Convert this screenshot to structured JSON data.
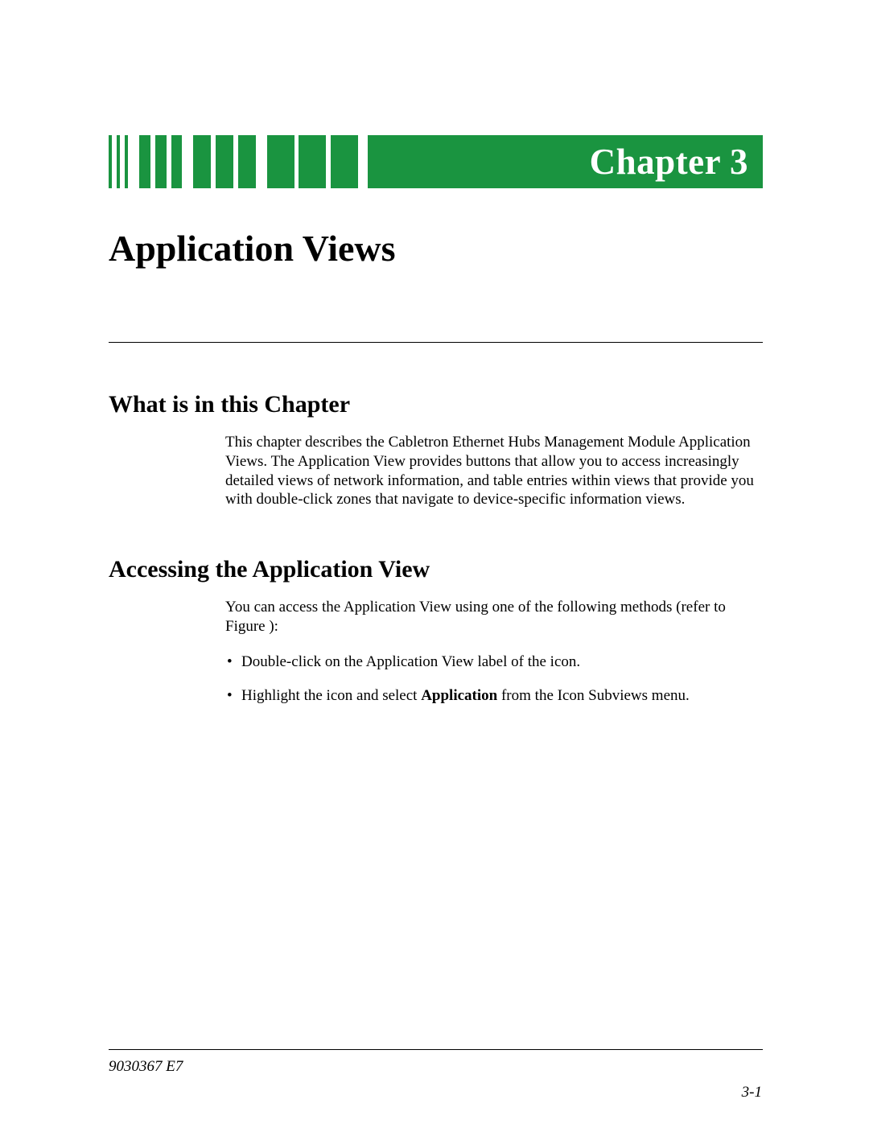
{
  "banner": {
    "label": "Chapter 3"
  },
  "chapter_title": "Application Views",
  "sections": {
    "s1": {
      "heading": "What is in this Chapter",
      "body": "This chapter describes the Cabletron Ethernet Hubs Management Module Application Views. The Application View provides buttons that allow you to access increasingly detailed views of network information, and table entries within views that provide you with double-click zones that navigate to device-specific information views."
    },
    "s2": {
      "heading": "Accessing the Application View",
      "intro": "You can access the Application View using one of the following methods (refer to Figure ):",
      "bullet1": "Double-click on the Application View label of the icon.",
      "bullet2_pre": "Highlight the icon and select ",
      "bullet2_bold": "Application",
      "bullet2_post": " from the Icon Subviews menu."
    }
  },
  "footer": {
    "doc_id": "9030367 E7",
    "page_num": "3-1"
  }
}
